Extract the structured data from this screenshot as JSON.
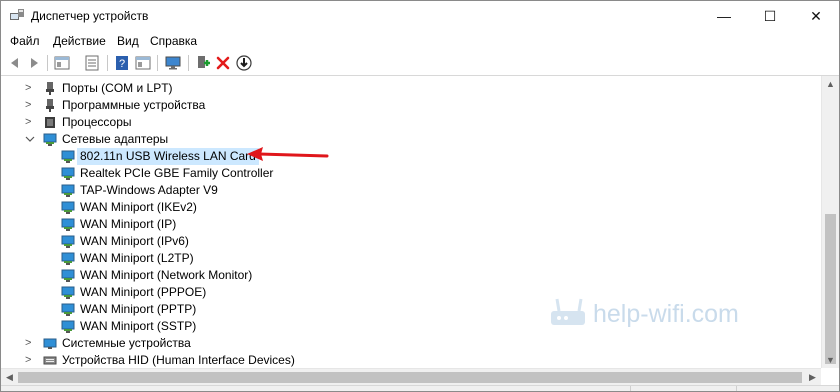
{
  "window": {
    "title": "Диспетчер устройств",
    "controls": {
      "minimize": "—",
      "maximize": "☐",
      "close": "✕"
    }
  },
  "menu": {
    "items": [
      "Файл",
      "Действие",
      "Вид",
      "Справка"
    ]
  },
  "toolbar": {
    "buttons": [
      "back-icon",
      "forward-icon",
      "show-hide-tree-icon",
      "properties-icon",
      "help-icon",
      "view-icon",
      "monitor-icon",
      "update-driver-icon",
      "uninstall-icon",
      "disable-icon"
    ]
  },
  "tree": {
    "rows": [
      {
        "label": "Порты (COM и LPT)",
        "expander": ">",
        "icon": "port-icon"
      },
      {
        "label": "Программные устройства",
        "expander": ">",
        "icon": "software-device-icon"
      },
      {
        "label": "Процессоры",
        "expander": ">",
        "icon": "cpu-icon"
      },
      {
        "label": "Сетевые адаптеры",
        "expander": "v",
        "icon": "network-adapter-icon"
      },
      {
        "label": "802.11n USB Wireless LAN Card",
        "icon": "network-adapter-icon",
        "selected": true
      },
      {
        "label": "Realtek PCIe GBE Family Controller",
        "icon": "network-adapter-icon"
      },
      {
        "label": "TAP-Windows Adapter V9",
        "icon": "network-adapter-icon"
      },
      {
        "label": "WAN Miniport (IKEv2)",
        "icon": "network-adapter-icon"
      },
      {
        "label": "WAN Miniport (IP)",
        "icon": "network-adapter-icon"
      },
      {
        "label": "WAN Miniport (IPv6)",
        "icon": "network-adapter-icon"
      },
      {
        "label": "WAN Miniport (L2TP)",
        "icon": "network-adapter-icon"
      },
      {
        "label": "WAN Miniport (Network Monitor)",
        "icon": "network-adapter-icon"
      },
      {
        "label": "WAN Miniport (PPPOE)",
        "icon": "network-adapter-icon"
      },
      {
        "label": "WAN Miniport (PPTP)",
        "icon": "network-adapter-icon"
      },
      {
        "label": "WAN Miniport (SSTP)",
        "icon": "network-adapter-icon"
      },
      {
        "label": "Системные устройства",
        "expander": ">",
        "icon": "system-device-icon"
      },
      {
        "label": "Устройства HID (Human Interface Devices)",
        "expander": ">",
        "icon": "hid-icon"
      }
    ]
  },
  "watermark": {
    "text": "help-wifi.com"
  },
  "colors": {
    "selection": "#cce8ff",
    "adapter_icon": "#2f8fd6",
    "annotation_arrow": "#e0161b",
    "uninstall": "#e31b1b"
  }
}
